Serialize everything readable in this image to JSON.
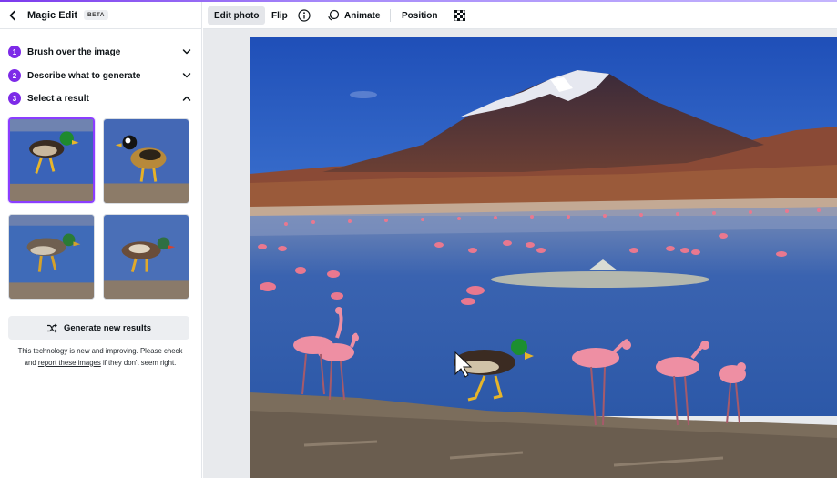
{
  "panel": {
    "title": "Magic Edit",
    "badge": "BETA",
    "steps": [
      {
        "num": "1",
        "label": "Brush over the image",
        "state": "collapsed"
      },
      {
        "num": "2",
        "label": "Describe what to generate",
        "state": "collapsed"
      },
      {
        "num": "3",
        "label": "Select a result",
        "state": "expanded"
      }
    ],
    "results_count": 4,
    "selected_result": 1,
    "generate_label": "Generate new results",
    "note_line1": "This technology is new and improving. Please check",
    "note_pre": "and",
    "note_link": "report these images",
    "note_post": "if they don't seem right."
  },
  "toolbar": {
    "edit_photo": "Edit photo",
    "flip": "Flip",
    "animate": "Animate",
    "position": "Position"
  },
  "icons": {
    "back": "chevron-left-icon",
    "collapsed": "chevron-down-icon",
    "expanded": "chevron-up-icon",
    "shuffle": "shuffle-icon",
    "info": "info-icon",
    "animate": "animate-icon",
    "transparency": "transparency-icon",
    "cursor": "mouse-pointer-icon"
  },
  "colors": {
    "accent": "#7d2ae8",
    "selected_border": "#8b3dff",
    "toolbar_active": "#e4e6ea"
  }
}
